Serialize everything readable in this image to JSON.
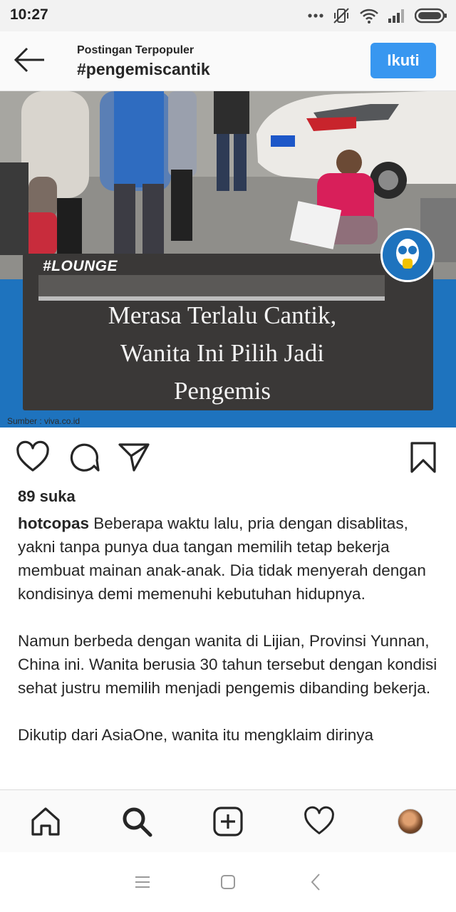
{
  "status_bar": {
    "time": "10:27",
    "icons": [
      "more-dots-icon",
      "mute-vibrate-icon",
      "wifi-icon",
      "signal-icon",
      "battery-icon"
    ]
  },
  "header": {
    "subtitle": "Postingan Terpopuler",
    "title": "#pengemiscantik",
    "follow_label": "Ikuti",
    "follow_color": "#3897f0"
  },
  "post_image": {
    "tag": "#LOUNGE",
    "headline_lines": [
      "Merasa Terlalu Cantik,",
      "Wanita Ini Pilih Jadi",
      "Pengemis"
    ],
    "source": "Sumber : viva.co.id",
    "brand_blue": "#1e73be"
  },
  "actions": {
    "icons": [
      "heart-icon",
      "comment-icon",
      "share-icon",
      "bookmark-icon"
    ]
  },
  "post": {
    "likes": "89 suka",
    "username": "hotcopas",
    "paragraphs": [
      "Beberapa waktu lalu, pria dengan disablitas, yakni tanpa punya dua tangan memilih tetap bekerja membuat mainan anak-anak. Dia tidak menyerah dengan kondisinya demi memenuhi kebutuhan hidupnya.",
      "Namun berbeda dengan wanita di Lijian, Provinsi Yunnan, China ini. Wanita berusia 30 tahun tersebut dengan kondisi sehat justru memilih menjadi pengemis dibanding bekerja.",
      "Dikutip dari AsiaOne, wanita itu mengklaim dirinya"
    ]
  },
  "bottom_nav": {
    "icons": [
      "home-icon",
      "search-icon",
      "add-post-icon",
      "activity-heart-icon",
      "profile-avatar"
    ]
  },
  "system_nav": {
    "icons": [
      "menu-icon",
      "home-square-icon",
      "back-chevron-icon"
    ]
  }
}
